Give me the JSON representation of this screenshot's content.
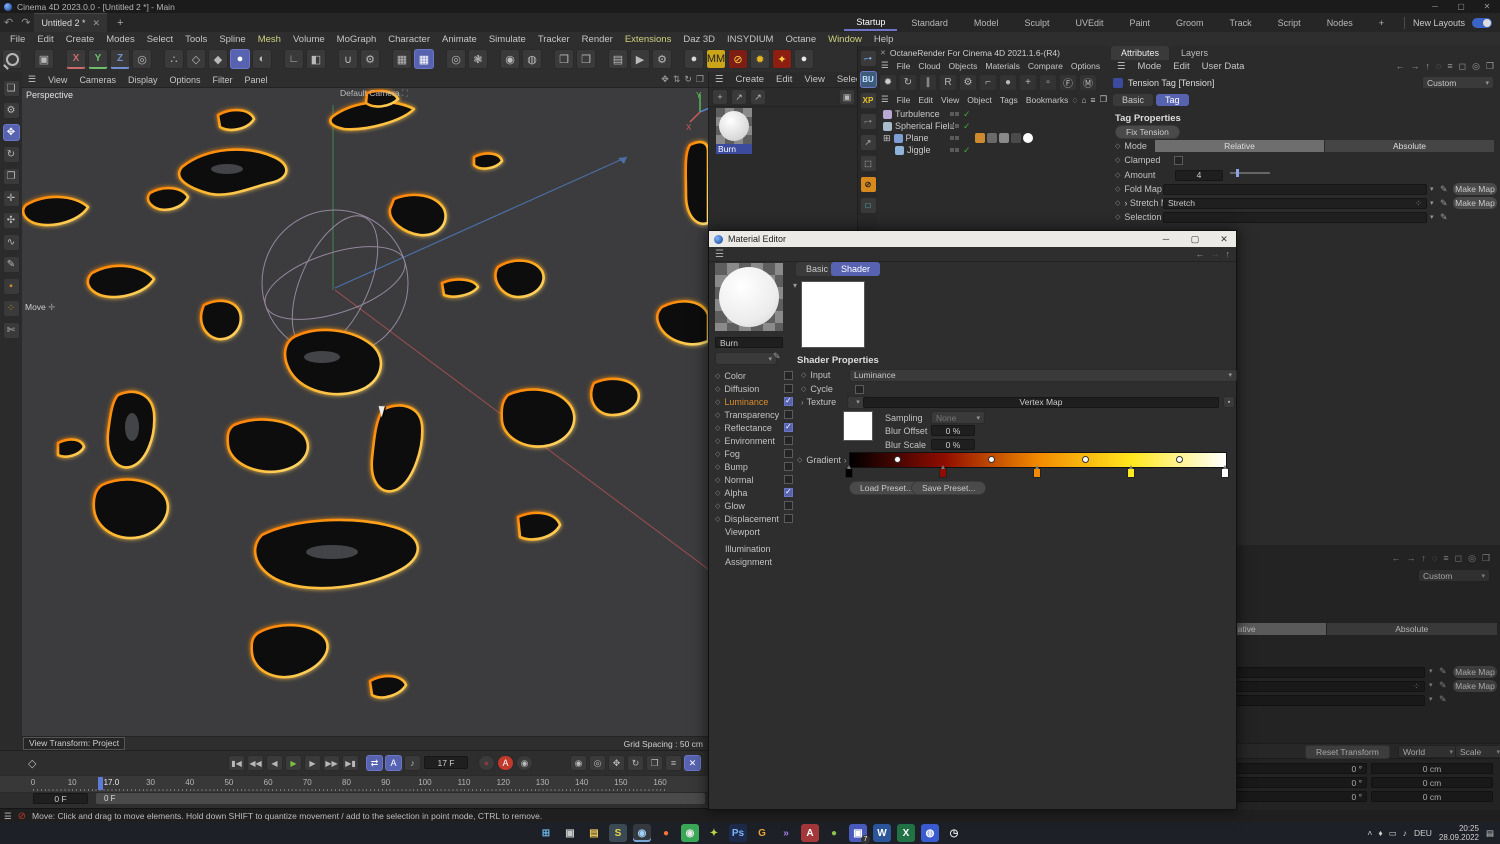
{
  "window": {
    "title": "Cinema 4D 2023.0.0 - [Untitled 2 *] - Main"
  },
  "tabbar": {
    "undo": "↶",
    "redo": "↷",
    "tab": "Untitled 2 *",
    "close": "✕",
    "add": "+",
    "layouts": [
      "Startup",
      "Standard",
      "Model",
      "Sculpt",
      "UVEdit",
      "Paint",
      "Groom",
      "Track",
      "Script",
      "Nodes",
      "+"
    ],
    "active_layout": "Startup",
    "new_layouts": "New Layouts"
  },
  "menubar": {
    "items": [
      "File",
      "Edit",
      "Create",
      "Modes",
      "Select",
      "Tools",
      "Spline",
      "Mesh",
      "Volume",
      "MoGraph",
      "Character",
      "Animate",
      "Simulate",
      "Tracker",
      "Render",
      "Extensions",
      "Daz 3D",
      "INSYDIUM",
      "Octane",
      "Window",
      "Help"
    ],
    "accent": [
      "Mesh",
      "Extensions",
      "Window"
    ]
  },
  "toolbar": {
    "groups": [
      [
        {
          "n": "search",
          "g": ""
        }
      ],
      [
        {
          "n": "last-tool",
          "g": "▣"
        }
      ],
      [
        {
          "n": "axis-x",
          "g": "X",
          "c": "#c96a6a",
          "cls": "axisletter"
        },
        {
          "n": "axis-y",
          "g": "Y",
          "c": "#6fbf6f",
          "cls": "axisletter"
        },
        {
          "n": "axis-z",
          "g": "Z",
          "c": "#6f8fd0",
          "cls": "axisletter"
        },
        {
          "n": "coord-system",
          "g": "◎"
        }
      ],
      [
        {
          "n": "points-mode",
          "g": "∴"
        },
        {
          "n": "edges-mode",
          "g": "◇"
        },
        {
          "n": "polygons-mode",
          "g": "◆"
        },
        {
          "n": "model-mode",
          "g": "●",
          "active": true
        },
        {
          "n": "object-mode",
          "g": "◐"
        }
      ],
      [
        {
          "n": "axis-mode",
          "g": "∟"
        },
        {
          "n": "workplane-mode",
          "g": "◧"
        }
      ],
      [
        {
          "n": "magnet",
          "g": "∪"
        },
        {
          "n": "magnet-settings",
          "g": "⚙"
        }
      ],
      [
        {
          "n": "snap-off",
          "g": "▦"
        },
        {
          "n": "snap-on",
          "g": "▦",
          "active": true
        }
      ],
      [
        {
          "n": "guides",
          "g": "◎"
        },
        {
          "n": "guide-settings",
          "g": "❃"
        }
      ],
      [
        {
          "n": "measure",
          "g": "◉"
        },
        {
          "n": "annotate",
          "g": "◍"
        }
      ],
      [
        {
          "n": "render-view",
          "g": "❒"
        },
        {
          "n": "render-all",
          "g": "❒"
        }
      ],
      [
        {
          "n": "render-region",
          "g": "▤"
        },
        {
          "n": "picture-viewer",
          "g": "▶"
        },
        {
          "n": "render-settings",
          "g": "⚙"
        }
      ],
      [
        {
          "n": "material-ball",
          "g": "●",
          "c": "#d8d8d8"
        },
        {
          "n": "mm-plugin",
          "g": "MM",
          "bg": "#caa419",
          "c": "#222"
        },
        {
          "n": "noise-off-plugin",
          "g": "⊘",
          "bg": "#7e1d14",
          "c": "#ffd23e"
        },
        {
          "n": "octane-plugin",
          "g": "✹",
          "bg": "#3a3a3a",
          "c": "#e8b820"
        },
        {
          "n": "fire-plugin",
          "g": "✦",
          "bg": "#8c1f12",
          "c": "#ffd23e"
        },
        {
          "n": "sphere-plugin",
          "g": "●",
          "c": "#e8e8e8"
        }
      ]
    ]
  },
  "left_toolbar": [
    {
      "n": "live-selection",
      "g": "❏"
    },
    {
      "n": "tweak",
      "g": "⚙"
    },
    {
      "n": "move",
      "g": "✥",
      "active": true
    },
    {
      "n": "rotate",
      "g": "↻"
    },
    {
      "n": "scale",
      "g": "❐"
    },
    {
      "n": "axis-tool",
      "g": "✛"
    },
    {
      "n": "transfer",
      "g": "✣"
    },
    {
      "n": "spline-smooth",
      "g": "∿"
    },
    {
      "n": "spline-pen",
      "g": "✎"
    },
    {
      "n": "marker",
      "g": "▪",
      "c": "#d08a2e"
    },
    {
      "n": "point-pair",
      "g": "⁘",
      "c": "#d08a2e"
    },
    {
      "n": "knife",
      "g": "✄"
    }
  ],
  "viewport": {
    "menus": [
      "View",
      "Cameras",
      "Display",
      "Options",
      "Filter",
      "Panel"
    ],
    "cam_icons": [
      {
        "n": "pan",
        "g": "✥"
      },
      {
        "n": "dolly",
        "g": "⇅"
      },
      {
        "n": "orbit",
        "g": "↻"
      },
      {
        "n": "toggle-panel",
        "g": "❐"
      }
    ],
    "projection": "Perspective",
    "camera": "Default Camera",
    "tool_hint": "Move",
    "transform": "View Transform: Project",
    "grid": "Grid Spacing : 50 cm"
  },
  "material_manager": {
    "menus": [
      "Create",
      "Edit",
      "View",
      "Select",
      ">"
    ],
    "tools": [
      {
        "n": "add-material",
        "g": "+"
      },
      {
        "n": "load-up",
        "g": "↗"
      },
      {
        "n": "load-down",
        "g": "↗"
      }
    ],
    "trash": "▣",
    "material": "Burn"
  },
  "plugin_strip": [
    {
      "n": "octane-lt",
      "g": "⌐•",
      "c": "#7fb4ff"
    },
    {
      "n": "bu-plugin",
      "g": "BU",
      "bg": "#3d5a78",
      "c": "#bfe2ff",
      "active": true
    },
    {
      "n": "xparticles",
      "g": "XP",
      "c": "#e8c62a"
    },
    {
      "n": "lt-gray",
      "g": "⌐•",
      "c": "#8a8a8a"
    },
    {
      "n": "expand",
      "g": "↗",
      "c": "#9a9a9a"
    },
    {
      "n": "dashed-box",
      "g": "⬚",
      "c": "#9a9a9a"
    },
    {
      "n": "no-entry",
      "g": "⊘",
      "bg": "#d88a1f",
      "c": "#222"
    },
    {
      "n": "cyan-frame",
      "g": "□",
      "c": "#5fd8d8"
    }
  ],
  "octane": {
    "close": "✕",
    "title": "OctaneRender For Cinema 4D 2021.1.6-(R4)",
    "menus": [
      "File",
      "Cloud",
      "Objects",
      "Materials",
      "Compare",
      "Options",
      ">"
    ],
    "icons": [
      {
        "n": "octane-logo",
        "g": "✹",
        "c": "#cfcfcf"
      },
      {
        "n": "sync",
        "g": "↻"
      },
      {
        "n": "pause",
        "g": "∥"
      },
      {
        "n": "restart",
        "g": "R"
      },
      {
        "n": "kernel-settings",
        "g": "⚙"
      },
      {
        "n": "lock",
        "g": "⌐"
      },
      {
        "n": "render-ball",
        "g": "●"
      },
      {
        "n": "add-box",
        "g": "+"
      },
      {
        "n": "small-box",
        "g": "▫"
      },
      {
        "n": "pin-f",
        "g": "Ⓕ"
      },
      {
        "n": "pin-m",
        "g": "Ⓜ"
      }
    ]
  },
  "object_manager": {
    "menus": [
      "File",
      "Edit",
      "View",
      "Object",
      "Tags",
      "Bookmarks"
    ],
    "header_icons": [
      {
        "n": "search",
        "g": "◌"
      },
      {
        "n": "home",
        "g": "⌂"
      },
      {
        "n": "filter",
        "g": "≡"
      },
      {
        "n": "export",
        "g": "❐"
      }
    ],
    "objects": [
      {
        "name": "Turbulence",
        "color": "#b9a8d4",
        "check": true,
        "indent": 0
      },
      {
        "name": "Spherical Field",
        "color": "#a8bccc",
        "check": true,
        "indent": 0
      },
      {
        "name": "Plane",
        "color": "#7f9fd4",
        "check": false,
        "indent": 0,
        "expand": true,
        "tags": true
      },
      {
        "name": "Jiggle",
        "color": "#8fb4d9",
        "check": true,
        "indent": 1
      }
    ],
    "plane_tags": [
      "#d08a2e",
      "#6a6a6a",
      "#8a8a8a",
      "#4a4a4a",
      "#ffffff"
    ]
  },
  "attributes": {
    "tabs": [
      "Attributes",
      "Layers"
    ],
    "active_tab": "Attributes",
    "menus": [
      "Mode",
      "Edit",
      "User Data"
    ],
    "nav_icons": [
      {
        "n": "back",
        "g": "←"
      },
      {
        "n": "forward",
        "g": "→"
      },
      {
        "n": "up",
        "g": "↑"
      },
      {
        "n": "search",
        "g": "◌"
      },
      {
        "n": "filter",
        "g": "≡"
      },
      {
        "n": "lock",
        "g": "◻"
      },
      {
        "n": "target",
        "g": "◎"
      },
      {
        "n": "popout",
        "g": "❐"
      }
    ],
    "object": "Tension Tag [Tension]",
    "preset": "Custom",
    "subtabs": [
      "Basic",
      "Tag"
    ],
    "active_subtab": "Tag",
    "section": "Tag Properties",
    "fix_button": "Fix Tension",
    "rows": {
      "mode": "Mode",
      "mode_options": [
        "Relative",
        "Absolute"
      ],
      "mode_active": "Relative",
      "clamped": "Clamped",
      "amount": "Amount",
      "amount_value": "4",
      "fold": "Fold Map",
      "stretch": "Stretch Map",
      "stretch_value": "Stretch",
      "selection": "Selection Tag"
    },
    "make_map": "Make Map"
  },
  "attributes_bottom": {
    "preset": "Custom",
    "mode_options": [
      "Relative",
      "Absolute"
    ],
    "make_map": "Make Map",
    "reset": "Reset Transform",
    "world": "World",
    "scale": "Scale",
    "coord_rows": [
      {
        "deg": "0 °",
        "len": "0 cm"
      },
      {
        "deg": "0 °",
        "len": "0 cm"
      },
      {
        "deg": "0 °",
        "len": "0 cm"
      }
    ]
  },
  "material_editor": {
    "title": "Material Editor",
    "name": "Burn",
    "tabs": [
      "Basic",
      "Shader"
    ],
    "active_tab": "Shader",
    "channels": [
      {
        "label": "Color",
        "checked": false
      },
      {
        "label": "Diffusion",
        "checked": false
      },
      {
        "label": "Luminance",
        "checked": true,
        "accent": true
      },
      {
        "label": "Transparency",
        "checked": false
      },
      {
        "label": "Reflectance",
        "checked": true
      },
      {
        "label": "Environment",
        "checked": false
      },
      {
        "label": "Fog",
        "checked": false
      },
      {
        "label": "Bump",
        "checked": false
      },
      {
        "label": "Normal",
        "checked": false
      },
      {
        "label": "Alpha",
        "checked": true
      },
      {
        "label": "Glow",
        "checked": false
      },
      {
        "label": "Displacement",
        "checked": false
      }
    ],
    "extras": [
      "Viewport",
      "Illumination",
      "Assignment"
    ],
    "props": {
      "heading": "Shader Properties",
      "input": "Input",
      "input_value": "Luminance",
      "cycle": "Cycle",
      "texture": "Texture",
      "texture_value": "Vertex Map",
      "sampling": "Sampling",
      "sampling_value": "None",
      "blur_offset": "Blur Offset",
      "blur_offset_value": "0 %",
      "blur_scale": "Blur Scale",
      "blur_scale_value": "0 %",
      "gradient": "Gradient",
      "load": "Load Preset...",
      "save": "Save Preset..."
    },
    "gradient": {
      "stops": [
        {
          "pos": 0,
          "color": "#000000"
        },
        {
          "pos": 25,
          "color": "#8f0c00"
        },
        {
          "pos": 50,
          "color": "#f28900"
        },
        {
          "pos": 75,
          "color": "#ffe81f"
        },
        {
          "pos": 100,
          "color": "#ffffff"
        }
      ],
      "bias_dots": [
        12.5,
        37.5,
        62.5,
        87.5
      ]
    }
  },
  "timeline": {
    "transport": [
      {
        "n": "goto-start",
        "g": "▮◀"
      },
      {
        "n": "prev-key",
        "g": "◀◀"
      },
      {
        "n": "prev-frame",
        "g": "◀"
      },
      {
        "n": "play",
        "g": "▶",
        "c": "#7ac142"
      },
      {
        "n": "next-frame",
        "g": "▶"
      },
      {
        "n": "next-key",
        "g": "▶▶"
      },
      {
        "n": "goto-end",
        "g": "▶▮"
      }
    ],
    "extra": [
      {
        "n": "loop",
        "g": "⇄",
        "active": true
      },
      {
        "n": "quantize",
        "g": "A",
        "active": true
      },
      {
        "n": "sound",
        "g": "♪"
      }
    ],
    "current": "17 F",
    "record": [
      {
        "n": "record",
        "g": "●",
        "c": "#8a3a3a"
      },
      {
        "n": "autokey",
        "g": "A",
        "bg": "#c0392b",
        "c": "#fff"
      },
      {
        "n": "keyframe",
        "g": "◉"
      }
    ],
    "record2": [
      {
        "n": "key-selection",
        "g": "◉"
      },
      {
        "n": "key-circle",
        "g": "◎"
      },
      {
        "n": "rec-position",
        "g": "✥"
      },
      {
        "n": "rec-rotation",
        "g": "↻"
      },
      {
        "n": "rec-scale",
        "g": "❐"
      },
      {
        "n": "rec-params",
        "g": "≡"
      },
      {
        "n": "rec-off",
        "g": "✕",
        "active": true
      }
    ],
    "frame_start": 0,
    "frame_end": 160,
    "tick_step": 10,
    "playhead_frame": 17,
    "playhead_label": "17.0",
    "range_a": "0 F",
    "range_b": "0 F"
  },
  "statusbar": {
    "text": "Move: Click and drag to move elements. Hold down SHIFT to quantize movement / add to the selection in point mode, CTRL to remove."
  },
  "taskbar": {
    "icons": [
      {
        "n": "start",
        "g": "⊞",
        "c": "#6cb2e8"
      },
      {
        "n": "clipboard",
        "g": "▣",
        "c": "#c9c9c9"
      },
      {
        "n": "file-explorer",
        "g": "▤",
        "c": "#e8c35a"
      },
      {
        "n": "sublime",
        "g": "S",
        "c": "#e8d44d",
        "bg": "#3b4a52"
      },
      {
        "n": "cinema4d",
        "g": "◉",
        "c": "#9fd0f5",
        "active": true
      },
      {
        "n": "firefox",
        "g": "●",
        "c": "#ff7139"
      },
      {
        "n": "chrome",
        "g": "◉",
        "c": "#e8e8e8",
        "bg": "#3aa757"
      },
      {
        "n": "screpter",
        "g": "✦",
        "c": "#b8d84a"
      },
      {
        "n": "photoshop",
        "g": "Ps",
        "c": "#7fb4ff",
        "bg": "#1d2a4a"
      },
      {
        "n": "gog",
        "g": "G",
        "c": "#e8a33d"
      },
      {
        "n": "arrows",
        "g": "»",
        "c": "#a87fe8"
      },
      {
        "n": "access",
        "g": "A",
        "c": "#fff",
        "bg": "#a4373a"
      },
      {
        "n": "greenshot",
        "g": "●",
        "c": "#8ac24a"
      },
      {
        "n": "teams",
        "g": "▣",
        "c": "#fff",
        "bg": "#4a5bbd",
        "badge": "7"
      },
      {
        "n": "word",
        "g": "W",
        "c": "#fff",
        "bg": "#2b579a"
      },
      {
        "n": "excel",
        "g": "X",
        "c": "#fff",
        "bg": "#217346"
      },
      {
        "n": "app-blue",
        "g": "◍",
        "c": "#fff",
        "bg": "#3b5bd0"
      },
      {
        "n": "clock-app",
        "g": "◷",
        "c": "#e8e8e8"
      }
    ],
    "tray_icons": [
      {
        "n": "tray-expand",
        "g": "˄"
      },
      {
        "n": "mic",
        "g": "♦"
      },
      {
        "n": "cast",
        "g": "▭"
      },
      {
        "n": "volume",
        "g": "♪"
      }
    ],
    "lang": "DEU",
    "time": "20:25",
    "date": "28.09.2022",
    "notif": "▤"
  }
}
